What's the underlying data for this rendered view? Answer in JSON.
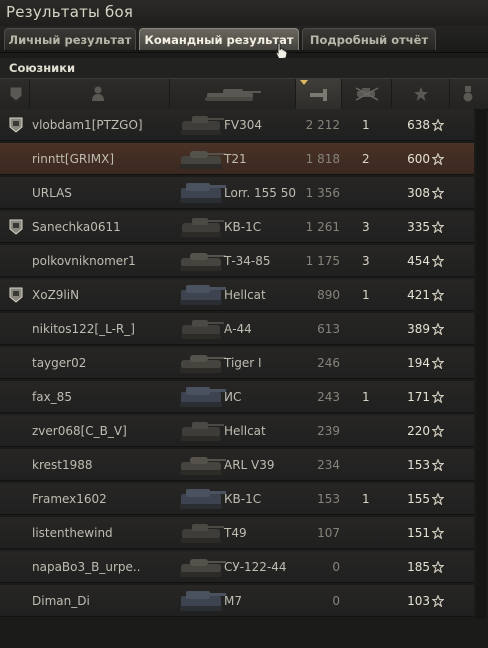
{
  "window": {
    "title": "Результаты боя"
  },
  "tabs": [
    {
      "label": "Личный результат",
      "active": false
    },
    {
      "label": "Командный результат",
      "active": true
    },
    {
      "label": "Подробный отчёт",
      "active": false
    }
  ],
  "section": {
    "title": "Союзники"
  },
  "columns": {
    "icons": [
      "badge-icon",
      "player-icon",
      "tank-icon",
      "damage-icon",
      "kills-icon",
      "xp-star-icon",
      "medal-icon"
    ],
    "sorted_column": "damage"
  },
  "rows": [
    {
      "name": "vlobdam1[PTZGO]",
      "vehicle": "FV304",
      "damage": "2 212",
      "kills": "1",
      "xp": "638",
      "badge": true,
      "self": false
    },
    {
      "name": "rinntt[GRIMX]",
      "vehicle": "T21",
      "damage": "1 818",
      "kills": "2",
      "xp": "600",
      "badge": false,
      "self": true
    },
    {
      "name": "URLAS",
      "vehicle": "Lorr. 155 50",
      "damage": "1 356",
      "kills": "",
      "xp": "308",
      "badge": false,
      "self": false
    },
    {
      "name": "Sanechka0611",
      "vehicle": "КВ-1С",
      "damage": "1 261",
      "kills": "3",
      "xp": "335",
      "badge": true,
      "self": false
    },
    {
      "name": "polkovniknomer1",
      "vehicle": "Т-34-85",
      "damage": "1 175",
      "kills": "3",
      "xp": "454",
      "badge": false,
      "self": false
    },
    {
      "name": "XoZ9liN",
      "vehicle": "Hellcat",
      "damage": "890",
      "kills": "1",
      "xp": "421",
      "badge": true,
      "self": false
    },
    {
      "name": "nikitos122[_L-R_]",
      "vehicle": "А-44",
      "damage": "613",
      "kills": "",
      "xp": "389",
      "badge": false,
      "self": false
    },
    {
      "name": "tayger02",
      "vehicle": "Tiger I",
      "damage": "246",
      "kills": "",
      "xp": "194",
      "badge": false,
      "self": false
    },
    {
      "name": "fax_85",
      "vehicle": "ИС",
      "damage": "243",
      "kills": "1",
      "xp": "171",
      "badge": false,
      "self": false
    },
    {
      "name": "zver068[C_B_V]",
      "vehicle": "Hellcat",
      "damage": "239",
      "kills": "",
      "xp": "220",
      "badge": false,
      "self": false
    },
    {
      "name": "krest1988",
      "vehicle": "ARL V39",
      "damage": "234",
      "kills": "",
      "xp": "153",
      "badge": false,
      "self": false
    },
    {
      "name": "Framex1602",
      "vehicle": "КВ-1С",
      "damage": "153",
      "kills": "1",
      "xp": "155",
      "badge": false,
      "self": false
    },
    {
      "name": "listenthewind",
      "vehicle": "T49",
      "damage": "107",
      "kills": "",
      "xp": "151",
      "badge": false,
      "self": false
    },
    {
      "name": "napaBo3_B_urpe..",
      "vehicle": "СУ-122-44",
      "damage": "0",
      "kills": "",
      "xp": "185",
      "badge": false,
      "self": false
    },
    {
      "name": "Diman_Di",
      "vehicle": "M7",
      "damage": "0",
      "kills": "",
      "xp": "103",
      "badge": false,
      "self": false
    }
  ],
  "colors": {
    "self_row": "#4a3226",
    "accent_text": "#e6e2d4"
  }
}
